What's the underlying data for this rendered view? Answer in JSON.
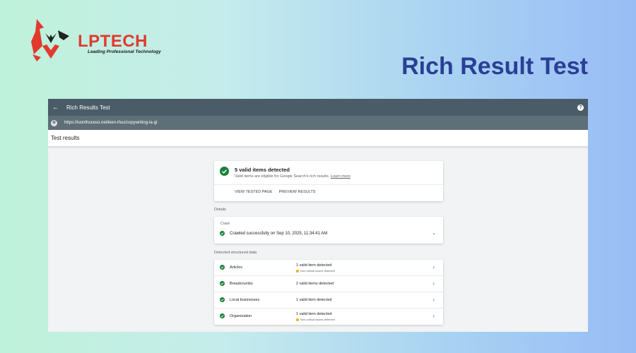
{
  "brand": {
    "name": "LPTECH",
    "tagline": "Leading Professional Technology",
    "colors": {
      "primary": "#e2392f",
      "title": "#2a3f95",
      "toolbar": "#4a5c67",
      "success": "#188038"
    }
  },
  "hero_title": "Rich Result Test",
  "app": {
    "title": "Rich Results Test",
    "back_icon": "back-arrow-icon",
    "help_icon": "help-icon",
    "url": "https://luonthuceso.net/kien-thuc/copywriting-la-gi",
    "subheader": "Test results",
    "summary": {
      "headline": "5 valid items detected",
      "description": "Valid items are eligible for Google Search's rich results.",
      "learn_more": "Learn more",
      "view_tested_page": "VIEW TESTED PAGE",
      "preview_results": "PREVIEW RESULTS"
    },
    "details_label": "Details",
    "crawl": {
      "label": "Crawl",
      "text": "Crawled successfully on Sep 10, 2025, 11:34:41 AM"
    },
    "structured_label": "Detected structured data",
    "items": [
      {
        "name": "Articles",
        "status": "1 valid item detected",
        "note": "Non-critical issues detected"
      },
      {
        "name": "Breadcrumbs",
        "status": "2 valid items detected",
        "note": ""
      },
      {
        "name": "Local businesses",
        "status": "1 valid item detected",
        "note": ""
      },
      {
        "name": "Organization",
        "status": "1 valid item detected",
        "note": "Non-critical issues detected"
      }
    ]
  }
}
